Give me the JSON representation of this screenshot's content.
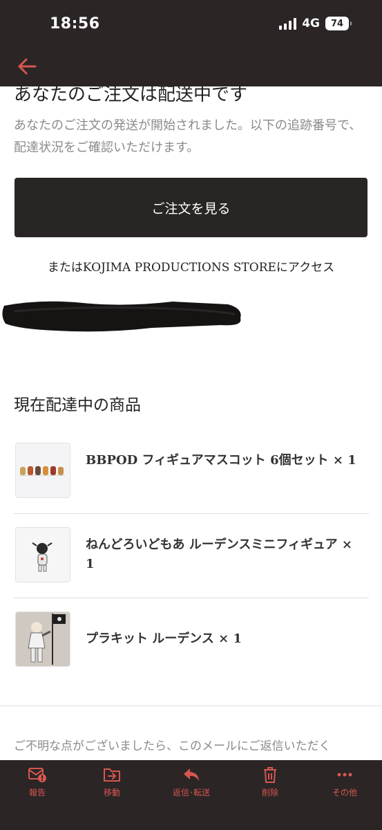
{
  "status_bar": {
    "time": "18:56",
    "network": "4G",
    "battery": "74"
  },
  "email": {
    "heading": "あなたのご注文は配送中です",
    "intro": "あなたのご注文の発送が開始されました。以下の追跡番号で、配達状況をご確認いただけます。",
    "view_order_button": "ご注文を見る",
    "store_prefix": "または",
    "store_name": "KOJIMA PRODUCTIONS STORE",
    "store_suffix": "にアクセス",
    "section_title": "現在配達中の商品",
    "items": [
      {
        "name": "BBPOD フィギュアマスコット 6個セット × 1",
        "thumb_icon": "bbpod-figures-thumbnail"
      },
      {
        "name": "ねんどろいどもあ ルーデンスミニフィギュア × 1",
        "thumb_icon": "ludens-mini-figure-thumbnail"
      },
      {
        "name": "プラキット ルーデンス × 1",
        "thumb_icon": "ludens-plastic-kit-thumbnail"
      }
    ],
    "footer_text": "ご不明な点がございましたら、このメールにご返信いただく"
  },
  "toolbar": {
    "report": "報告",
    "move": "移動",
    "reply_forward": "返信･転送",
    "delete": "削除",
    "more": "その他"
  },
  "colors": {
    "dark": "#2b2526",
    "accent": "#d6574f",
    "muted_text": "#8a8a8a"
  }
}
